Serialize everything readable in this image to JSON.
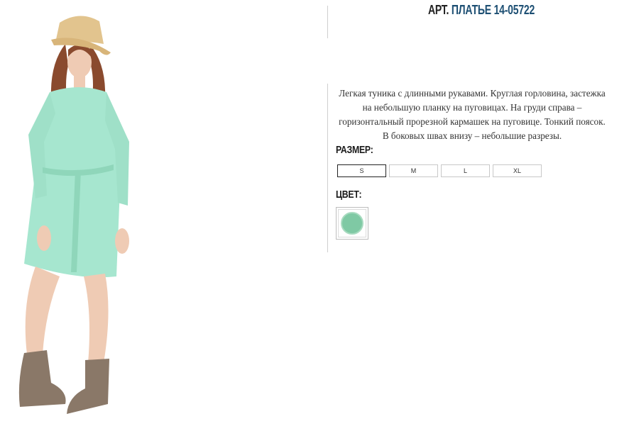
{
  "product": {
    "title_prefix": "АРТ.",
    "title_name": "ПЛАТЬЕ 14-05722",
    "description": "Легкая туника с длинными рукавами. Круглая горловина, застежка на небольшую планку на пуговицах. На груди справа – горизонтальный прорезной кармашек на пуговице. Тонкий поясок. В боковых швах внизу – небольшие разрезы."
  },
  "size_section": {
    "label": "РАЗМЕР:",
    "options": [
      "S",
      "M",
      "L",
      "XL"
    ],
    "selected": "S"
  },
  "color_section": {
    "label": "ЦВЕТ:",
    "swatches": [
      {
        "name": "mint",
        "color": "#7fc9a4"
      }
    ]
  },
  "image": {
    "alt_icon": "model-photo",
    "dress_color": "#a6e6cf",
    "hat_color": "#e2c48e",
    "boots_color": "#8a7868"
  }
}
